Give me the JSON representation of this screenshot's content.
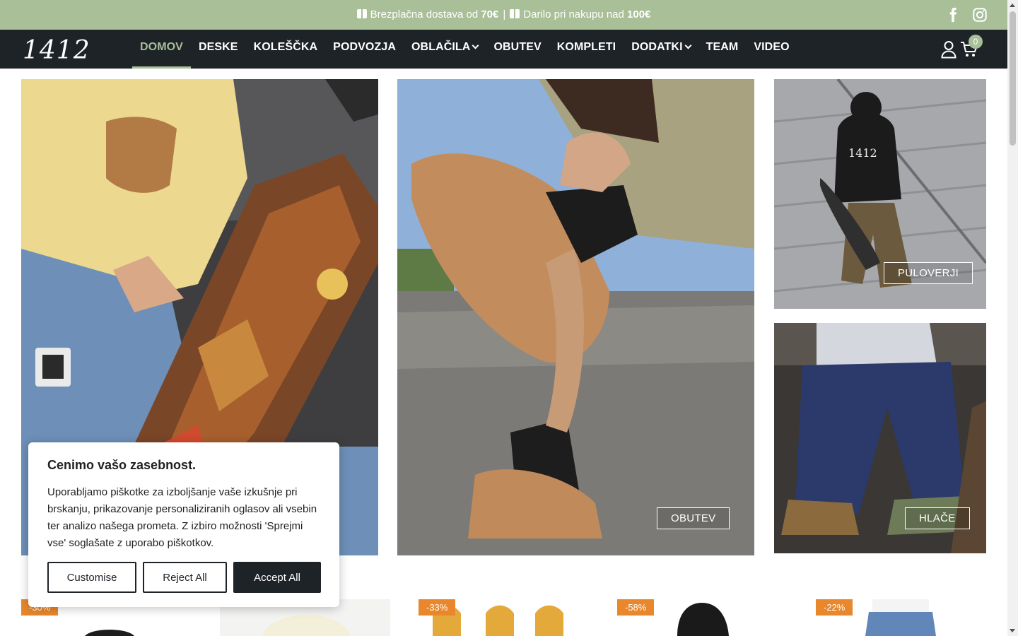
{
  "promo": {
    "shipping_text": "Brezplačna dostava od ",
    "shipping_amount": "70€",
    "separator": "|",
    "gift_text": "Darilo pri nakupu nad ",
    "gift_amount": "100€"
  },
  "brand": {
    "logo_text": "1412"
  },
  "nav": {
    "items": [
      {
        "label": "DOMOV",
        "active": true
      },
      {
        "label": "DESKE"
      },
      {
        "label": "KOLEŠČKA"
      },
      {
        "label": "PODVOZJA"
      },
      {
        "label": "OBLAČILA",
        "dropdown": true
      },
      {
        "label": "OBUTEV"
      },
      {
        "label": "KOMPLETI"
      },
      {
        "label": "DODATKI",
        "dropdown": true
      },
      {
        "label": "TEAM"
      },
      {
        "label": "VIDEO"
      }
    ],
    "cart_count": "0",
    "icons": [
      "user-icon",
      "cart-icon",
      "facebook-icon",
      "instagram-icon"
    ]
  },
  "tiles": {
    "shoes_label": "OBUTEV",
    "sweaters_label": "PULOVERJI",
    "pants_label": "HLAČE"
  },
  "cookie": {
    "title": "Cenimo vašo zasebnost.",
    "text": "Uporabljamo piškotke za izboljšanje vaše izkušnje pri brskanju, prikazovanje personaliziranih oglasov ali vsebin ter analizo našega prometa. Z izbiro možnosti 'Sprejmi vse' soglašate z uporabo piškotkov.",
    "customise": "Customise",
    "reject": "Reject All",
    "accept": "Accept All"
  },
  "products": {
    "discounts": [
      "-30%",
      "-33%",
      "-58%",
      "-22%"
    ]
  },
  "colors": {
    "accent": "#a8bf98",
    "nav_bg": "#1e2328",
    "discount": "#e8872c"
  }
}
